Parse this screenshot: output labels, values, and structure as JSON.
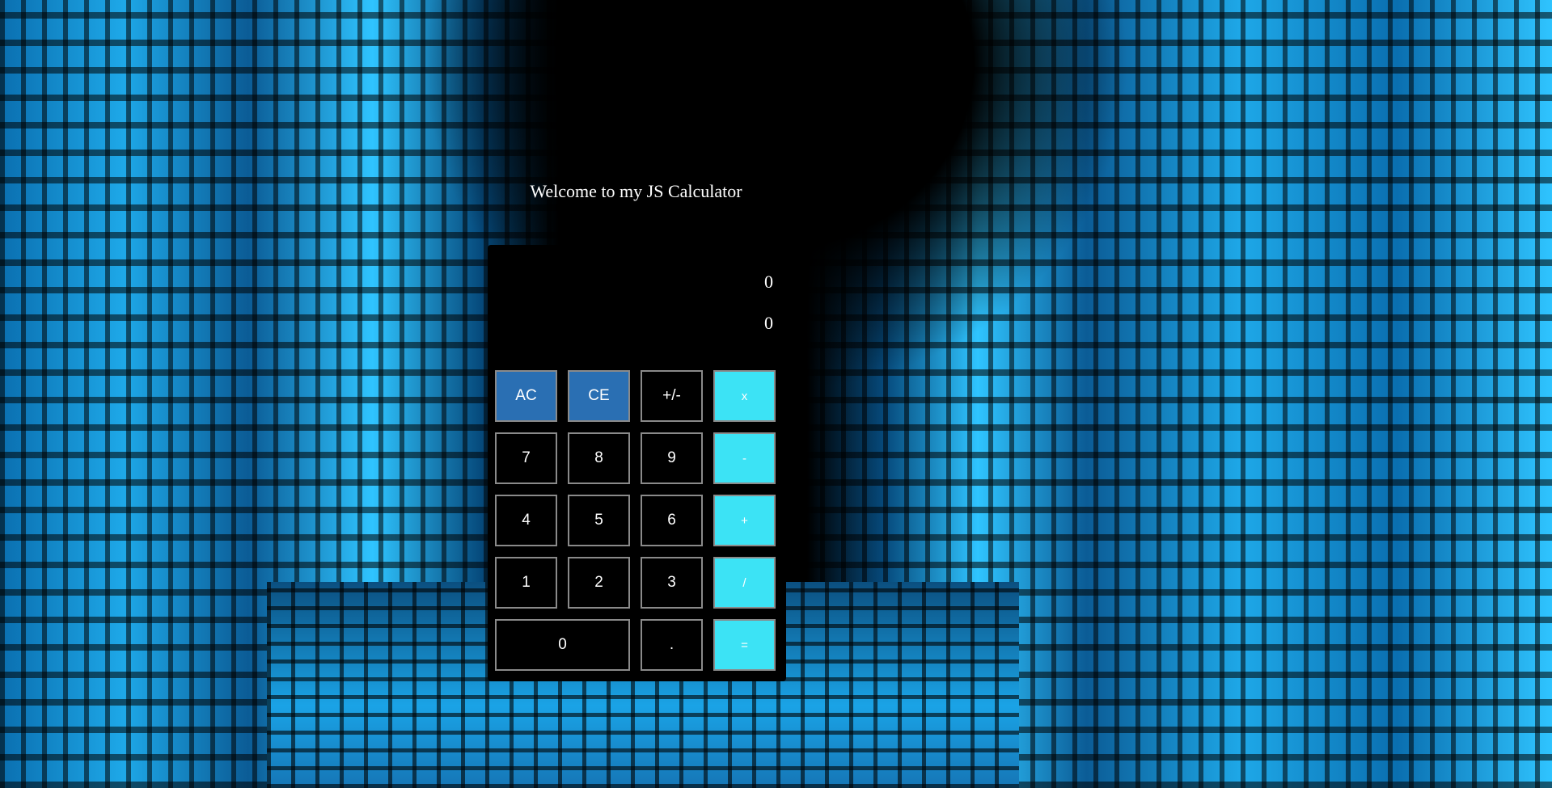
{
  "page": {
    "title": "Welcome to my JS Calculator"
  },
  "display": {
    "previous": "0",
    "current": "0"
  },
  "keys": {
    "ac": "AC",
    "ce": "CE",
    "sign": "+/-",
    "multiply": "x",
    "seven": "7",
    "eight": "8",
    "nine": "9",
    "minus": "-",
    "four": "4",
    "five": "5",
    "six": "6",
    "plus": "+",
    "one": "1",
    "two": "2",
    "three": "3",
    "divide": "/",
    "zero": "0",
    "decimal": ".",
    "equals": "="
  },
  "colors": {
    "clear_key": "#2a6fb3",
    "operator_key": "#3ce3f5",
    "calculator_body": "#000000",
    "background_accent": "#1ea8e8"
  }
}
